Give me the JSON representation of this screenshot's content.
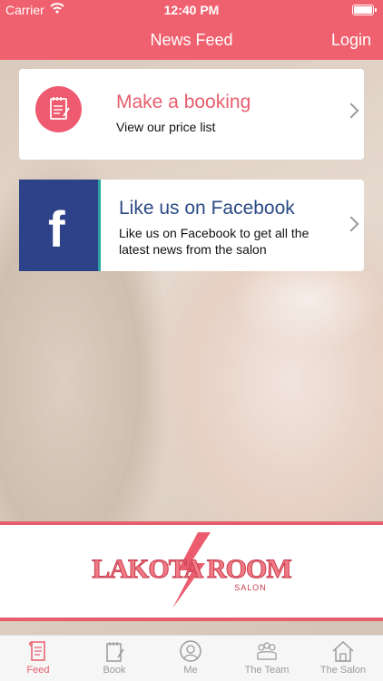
{
  "status": {
    "carrier": "Carrier",
    "time": "12:40 PM"
  },
  "nav": {
    "title": "News Feed",
    "login": "Login"
  },
  "booking": {
    "title": "Make a booking",
    "subtitle": "View our price list",
    "icon": "notepad-icon"
  },
  "facebook": {
    "title": "Like us on Facebook",
    "subtitle": "Like us on Facebook to get all the latest news from the salon",
    "icon": "facebook-icon"
  },
  "logo": {
    "line1": "LAKOTA ROOM",
    "line2": "SALON"
  },
  "tabs": [
    {
      "label": "Feed",
      "icon": "feed-icon",
      "active": true
    },
    {
      "label": "Book",
      "icon": "book-icon",
      "active": false
    },
    {
      "label": "Me",
      "icon": "me-icon",
      "active": false
    },
    {
      "label": "The Team",
      "icon": "team-icon",
      "active": false
    },
    {
      "label": "The Salon",
      "icon": "salon-icon",
      "active": false
    }
  ],
  "colors": {
    "brand": "#f0616f",
    "facebook": "#2d4288",
    "accent_text": "#e75d6d"
  }
}
